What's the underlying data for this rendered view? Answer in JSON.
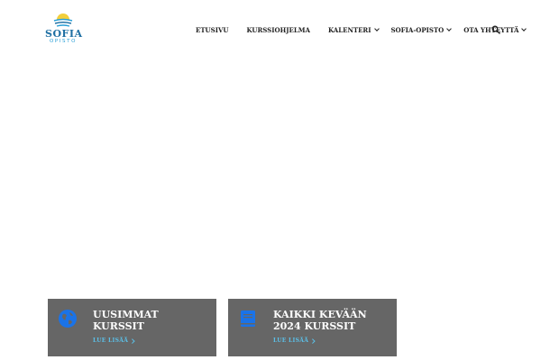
{
  "logo": {
    "word": "SOFIA",
    "sub": "OPISTO"
  },
  "nav": {
    "items": [
      {
        "label": "ETUSIVU",
        "has_dropdown": false
      },
      {
        "label": "KURSSIOHJELMA",
        "has_dropdown": false
      },
      {
        "label": "KALENTERI",
        "has_dropdown": true
      },
      {
        "label": "SOFIA-OPISTO",
        "has_dropdown": true
      },
      {
        "label": "OTA YHTEYTTÄ",
        "has_dropdown": true
      }
    ],
    "search_icon": "search-icon"
  },
  "cards": [
    {
      "title_line1": "UUSIMMAT",
      "title_line2": "KURSSIT",
      "link": "LUE LISÄÄ",
      "icon": "globe-icon"
    },
    {
      "title_line1": "KAIKKI KEVÄÄN",
      "title_line2": "2024 KURSSIT",
      "link": "LUE LISÄÄ",
      "icon": "book-icon"
    }
  ],
  "colors": {
    "card_bg": "#666666",
    "accent_blue": "#1e6fa3",
    "icon_blue": "#1a73e8",
    "link_blue": "#5bc0e8"
  }
}
